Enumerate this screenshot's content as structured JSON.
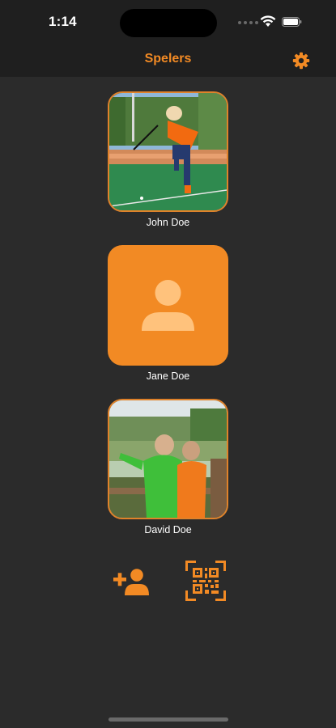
{
  "status_bar": {
    "time": "1:14"
  },
  "nav": {
    "title": "Spelers",
    "settings_icon": "gear-icon"
  },
  "players": [
    {
      "name": "John Doe",
      "photo": "field-hockey-player-photo"
    },
    {
      "name": "Jane Doe",
      "photo": "person-placeholder-icon"
    },
    {
      "name": "David Doe",
      "photo": "two-boys-at-zoo-photo"
    }
  ],
  "actions": {
    "add_player_icon": "person-add-icon",
    "scan_qr_icon": "qr-code-scan-icon"
  },
  "colors": {
    "accent": "#f28a24",
    "background": "#2b2b2b",
    "bar_background": "#1f1f1f"
  }
}
